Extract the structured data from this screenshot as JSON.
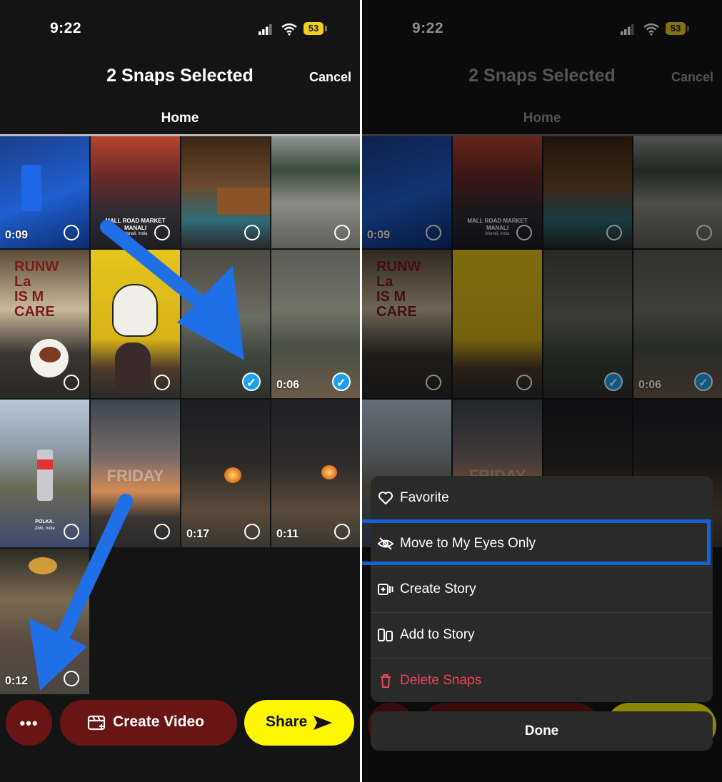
{
  "status": {
    "time": "9:22",
    "battery": "53"
  },
  "header": {
    "title": "2 Snaps Selected",
    "cancel": "Cancel",
    "tab": "Home"
  },
  "tiles": [
    {
      "duration": "0:09",
      "selected": false
    },
    {
      "caption": "MALL ROAD MARKET\nMANALI",
      "sub": "Manali, India",
      "selected": false
    },
    {
      "selected": false
    },
    {
      "selected": false
    },
    {
      "caption": "RUNW\nLa\nIS M\nCARE",
      "selected": false
    },
    {
      "selected": false
    },
    {
      "selected": true
    },
    {
      "duration": "0:06",
      "selected": true
    },
    {
      "caption": "POLKA.",
      "sub": "Jibhi, India",
      "selected": false
    },
    {
      "caption": "FRIDAY",
      "selected": false
    },
    {
      "duration": "0:17",
      "selected": false
    },
    {
      "duration": "0:11",
      "selected": false
    },
    {
      "duration": "0:12",
      "selected": false
    }
  ],
  "bottom_bar": {
    "more": "•••",
    "create_video": "Create Video",
    "share": "Share"
  },
  "menu": {
    "items": [
      {
        "label": "Favorite",
        "icon": "heart-icon"
      },
      {
        "label": "Move to My Eyes Only",
        "icon": "eye-slash-icon"
      },
      {
        "label": "Create Story",
        "icon": "create-story-icon"
      },
      {
        "label": "Add to Story",
        "icon": "add-story-icon"
      },
      {
        "label": "Delete Snaps",
        "icon": "trash-icon"
      }
    ],
    "done": "Done"
  },
  "colors": {
    "accent": "#1aa0f4",
    "danger": "#f0445a",
    "share": "#fff600",
    "button_red": "#6a1515",
    "highlight": "#1463d6"
  }
}
